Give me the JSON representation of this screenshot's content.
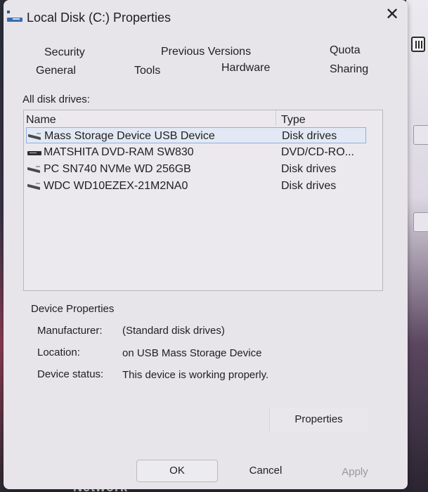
{
  "window": {
    "title": "Local Disk (C:) Properties",
    "close_symbol": "✕"
  },
  "tabs": {
    "security": "Security",
    "previous_versions": "Previous Versions",
    "quota": "Quota",
    "general": "General",
    "tools": "Tools",
    "hardware": "Hardware",
    "sharing": "Sharing"
  },
  "drives_section": {
    "label": "All disk drives:",
    "header_name": "Name",
    "header_type": "Type",
    "rows": [
      {
        "name": "Mass Storage Device USB Device",
        "type": "Disk drives",
        "icon": "disk-drive-icon",
        "selected": true
      },
      {
        "name": "MATSHITA DVD-RAM SW830",
        "type": "DVD/CD-RO...",
        "icon": "dvd-drive-icon",
        "selected": false
      },
      {
        "name": "PC SN740 NVMe WD 256GB",
        "type": "Disk drives",
        "icon": "disk-drive-icon",
        "selected": false
      },
      {
        "name": "WDC WD10EZEX-21M2NA0",
        "type": "Disk drives",
        "icon": "disk-drive-icon",
        "selected": false
      }
    ]
  },
  "device_properties": {
    "title": "Device Properties",
    "manufacturer_label": "Manufacturer:",
    "manufacturer_value": "(Standard disk drives)",
    "location_label": "Location:",
    "location_value": "on USB Mass Storage Device",
    "status_label": "Device status:",
    "status_value": "This device is working properly."
  },
  "buttons": {
    "properties": "Properties",
    "ok": "OK",
    "cancel": "Cancel",
    "apply": "Apply"
  },
  "background": {
    "taskbar_text": "Network"
  },
  "colors": {
    "dialog_bg": "#e7e4ea",
    "selection_border": "#8db0dc",
    "disabled_text": "#9a97a0"
  }
}
